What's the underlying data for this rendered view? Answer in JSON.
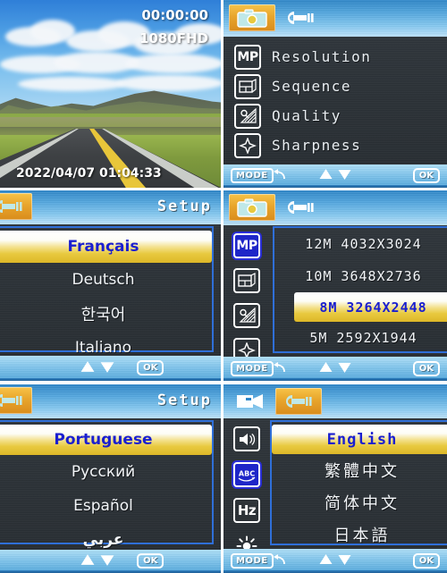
{
  "panels": {
    "live_view": {
      "osd_timer": "00:00:00",
      "osd_resolution": "1080FHD",
      "osd_datetime": "2022/04/07 01:04:33"
    },
    "photo_menu": {
      "tabs": [
        {
          "name": "camera-tab",
          "icon": "camera-icon",
          "selected": true
        },
        {
          "name": "setup-tab",
          "icon": "wrench-icon",
          "selected": false
        }
      ],
      "items": [
        {
          "icon": "mp-icon",
          "label": "Resolution"
        },
        {
          "icon": "sequence-icon",
          "label": "Sequence"
        },
        {
          "icon": "quality-icon",
          "label": "Quality"
        },
        {
          "icon": "sharpness-icon",
          "label": "Sharpness"
        }
      ],
      "bottom": {
        "mode": "MODE",
        "back": "back-arrow-icon",
        "up": "up-arrow-icon",
        "down": "down-arrow-icon",
        "ok": "OK"
      }
    },
    "setup_language_1": {
      "title": "Setup",
      "tabs": [
        {
          "name": "setup-tab",
          "icon": "wrench-icon",
          "selected": true
        }
      ],
      "options": [
        {
          "label": "Français",
          "selected": true
        },
        {
          "label": "Deutsch",
          "selected": false
        },
        {
          "label": "한국어",
          "selected": false
        },
        {
          "label": "Italiano",
          "selected": false
        }
      ],
      "bottom": {
        "up": "up-arrow-icon",
        "down": "down-arrow-icon",
        "ok": "OK"
      }
    },
    "resolution_menu": {
      "tabs": [
        {
          "name": "camera-tab",
          "icon": "camera-icon",
          "selected": true
        },
        {
          "name": "setup-tab",
          "icon": "wrench-icon",
          "selected": false
        }
      ],
      "rail": [
        {
          "icon": "mp-icon",
          "active": true
        },
        {
          "icon": "sequence-icon",
          "active": false
        },
        {
          "icon": "quality-icon",
          "active": false
        },
        {
          "icon": "sharpness-icon",
          "active": false
        }
      ],
      "options": [
        {
          "label": "12M  4032X3024",
          "selected": false
        },
        {
          "label": "10M  3648X2736",
          "selected": false
        },
        {
          "label": "8M  3264X2448",
          "selected": true
        },
        {
          "label": "5M  2592X1944",
          "selected": false
        }
      ],
      "bottom": {
        "mode": "MODE",
        "back": "back-arrow-icon",
        "up": "up-arrow-icon",
        "down": "down-arrow-icon",
        "ok": "OK"
      }
    },
    "setup_language_2": {
      "title": "Setup",
      "tabs": [
        {
          "name": "setup-tab",
          "icon": "wrench-icon",
          "selected": true
        }
      ],
      "options": [
        {
          "label": "Portuguese",
          "selected": true
        },
        {
          "label": "Русский",
          "selected": false
        },
        {
          "label": "Español",
          "selected": false
        },
        {
          "label": "عربي",
          "selected": false
        }
      ],
      "bottom": {
        "up": "up-arrow-icon",
        "down": "down-arrow-icon",
        "ok": "OK"
      }
    },
    "setup_language_3": {
      "tabs": [
        {
          "name": "video-tab",
          "icon": "video-camera-icon",
          "selected": false
        },
        {
          "name": "setup-tab",
          "icon": "wrench-icon",
          "selected": true
        }
      ],
      "rail": [
        {
          "icon": "speaker-icon",
          "active": false
        },
        {
          "icon": "abc-language-icon",
          "active": true
        },
        {
          "icon": "hz-frequency-icon",
          "active": false
        },
        {
          "icon": "brightness-sun-icon",
          "active": false
        }
      ],
      "options": [
        {
          "label": "English",
          "selected": true
        },
        {
          "label": "繁體中文",
          "selected": false
        },
        {
          "label": "简体中文",
          "selected": false
        },
        {
          "label": "日本語",
          "selected": false
        }
      ],
      "bottom": {
        "mode": "MODE",
        "back": "back-arrow-icon",
        "up": "up-arrow-icon",
        "down": "down-arrow-icon",
        "ok": "OK"
      }
    }
  },
  "colors": {
    "highlight_gold": "#e8c93f",
    "highlight_text": "#1a1fd0",
    "tab_selected": "#e8a52c",
    "frame_blue": "#2f6fd8",
    "lcd_bg": "#2d3338"
  }
}
